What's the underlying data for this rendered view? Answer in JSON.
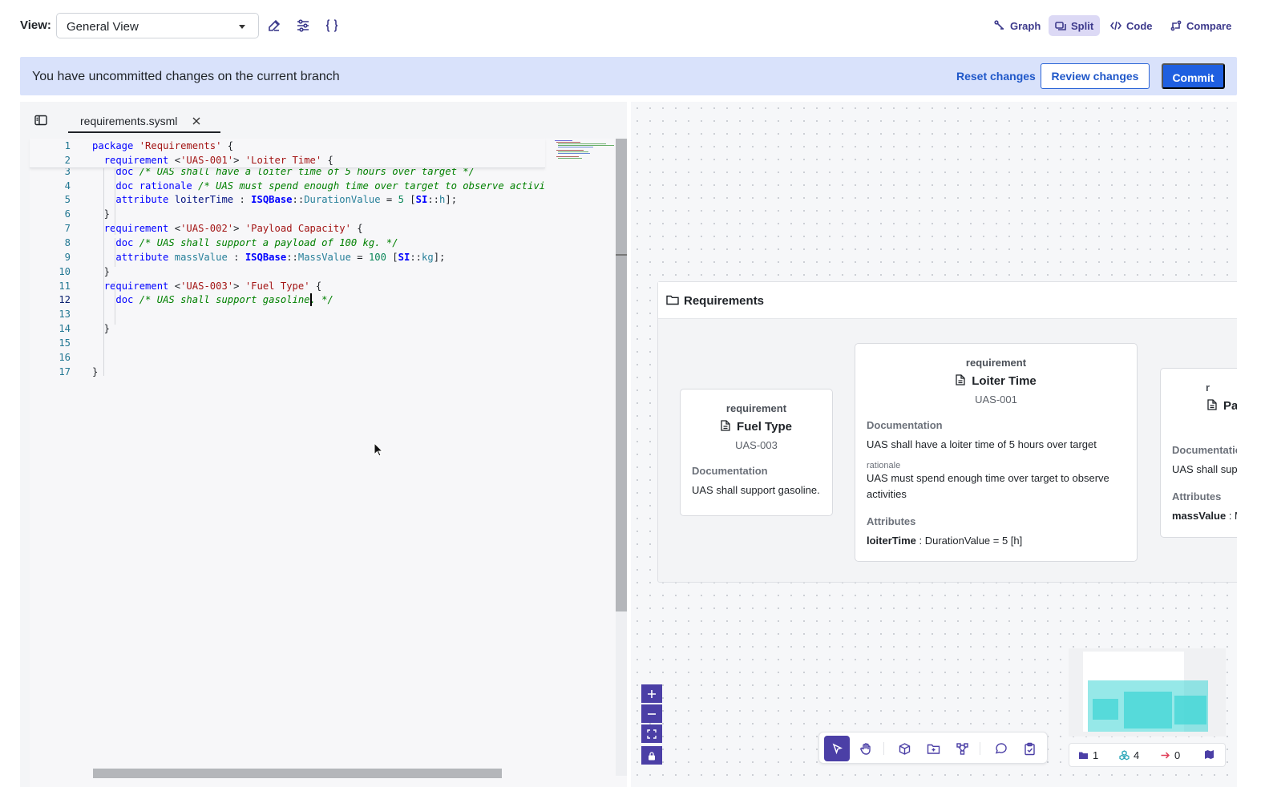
{
  "toolbar": {
    "view_label": "View:",
    "view_value": "General View",
    "modes": [
      {
        "label": "Graph",
        "icon": "graph-icon",
        "active": false
      },
      {
        "label": "Split",
        "icon": "split-icon",
        "active": true
      },
      {
        "label": "Code",
        "icon": "code-icon",
        "active": false
      },
      {
        "label": "Compare",
        "icon": "compare-icon",
        "active": false
      }
    ]
  },
  "banner": {
    "message": "You have uncommitted changes on the current branch",
    "reset_label": "Reset changes",
    "review_label": "Review changes",
    "commit_label": "Commit"
  },
  "editor": {
    "tab_name": "requirements.sysml",
    "current_line": 12,
    "lines": [
      {
        "n": "1",
        "text": "package 'Requirements' {"
      },
      {
        "n": "2",
        "text": "  requirement <'UAS-001'> 'Loiter Time' {"
      },
      {
        "n": "3",
        "text": "    doc /* UAS shall have a loiter time of 5 hours over target */"
      },
      {
        "n": "4",
        "text": "    doc rationale /* UAS must spend enough time over target to observe activiti"
      },
      {
        "n": "5",
        "text": "    attribute loiterTime : ISQBase::DurationValue = 5 [SI::h];"
      },
      {
        "n": "6",
        "text": "  }"
      },
      {
        "n": "7",
        "text": "  requirement <'UAS-002'> 'Payload Capacity' {"
      },
      {
        "n": "8",
        "text": "    doc /* UAS shall support a payload of 100 kg. */"
      },
      {
        "n": "9",
        "text": "    attribute massValue : ISQBase::MassValue = 100 [SI::kg];"
      },
      {
        "n": "10",
        "text": "  }"
      },
      {
        "n": "11",
        "text": "  requirement <'UAS-003'> 'Fuel Type' {"
      },
      {
        "n": "12",
        "text": "    doc /* UAS shall support gasoline. */"
      },
      {
        "n": "13",
        "text": ""
      },
      {
        "n": "14",
        "text": "  }"
      },
      {
        "n": "15",
        "text": ""
      },
      {
        "n": "16",
        "text": ""
      },
      {
        "n": "17",
        "text": "}"
      }
    ]
  },
  "graph": {
    "package_title": "Requirements",
    "cards": [
      {
        "kind": "requirement",
        "name": "Fuel Type",
        "id": "UAS-003",
        "doc_heading": "Documentation",
        "doc": "UAS shall support gasoline."
      },
      {
        "kind": "requirement",
        "name": "Loiter Time",
        "id": "UAS-001",
        "doc_heading": "Documentation",
        "doc": "UAS shall have a loiter time of 5 hours over target",
        "rationale_label": "rationale",
        "rationale": "UAS must spend enough time over target to observe activities",
        "attr_heading": "Attributes",
        "attr_name": "loiterTime",
        "attr_value": " : DurationValue = 5 [h]"
      },
      {
        "kind": "r",
        "name": "Pa",
        "doc_heading": "Documentatio",
        "doc": "UAS shall supp",
        "attr_heading": "Attributes",
        "attr_name": "massValue",
        "attr_value": " : M"
      }
    ],
    "stats": {
      "packages": "1",
      "elements": "4",
      "relations": "0"
    }
  },
  "colors": {
    "accent": "#4b3fa6",
    "primary": "#1f5fe0",
    "banner": "#d9e2fb"
  }
}
